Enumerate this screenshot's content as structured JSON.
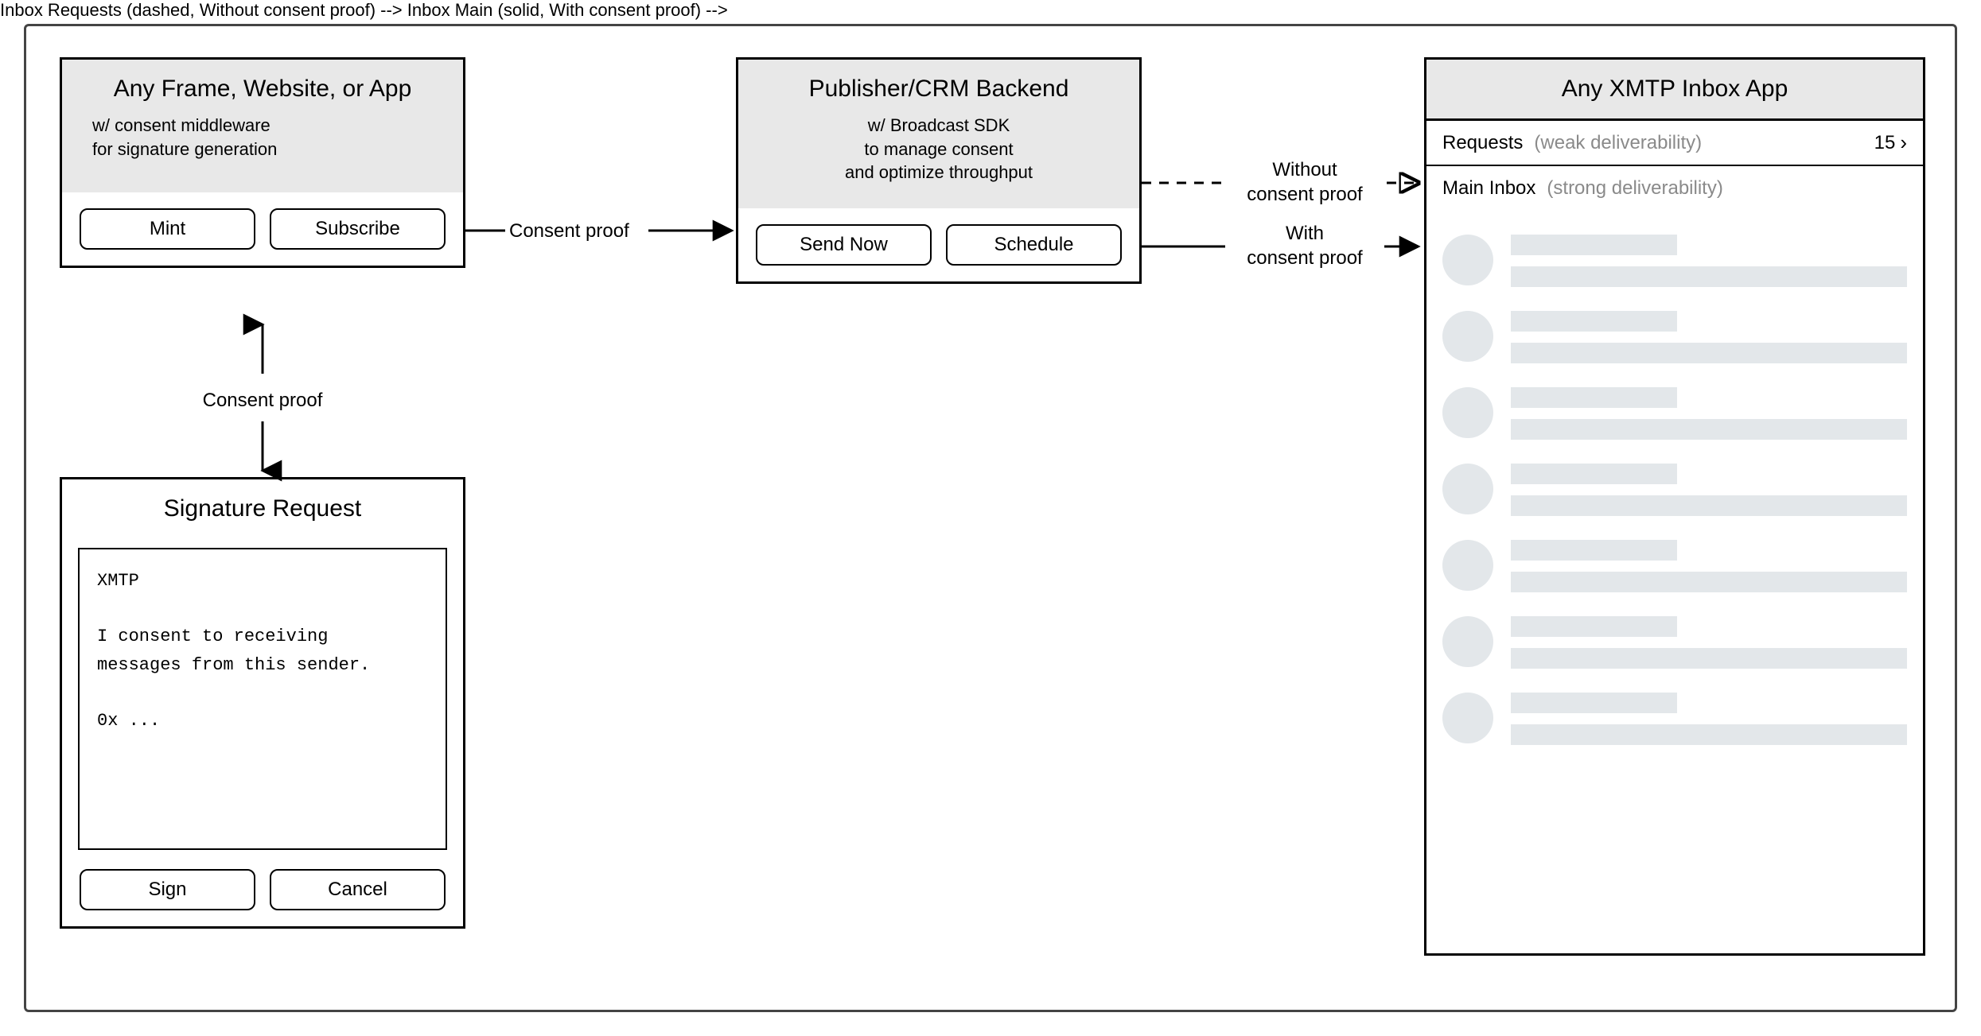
{
  "frontend": {
    "title": "Any Frame, Website, or App",
    "subtitle": "w/ consent middleware\nfor signature generation",
    "mint_label": "Mint",
    "subscribe_label": "Subscribe"
  },
  "backend": {
    "title": "Publisher/CRM Backend",
    "subtitle": "w/ Broadcast SDK\nto manage consent\nand optimize throughput",
    "send_now_label": "Send Now",
    "schedule_label": "Schedule"
  },
  "signature": {
    "title": "Signature Request",
    "body": "XMTP\n\nI consent to receiving\nmessages from this sender.\n\n0x ...",
    "sign_label": "Sign",
    "cancel_label": "Cancel"
  },
  "inbox": {
    "title": "Any XMTP Inbox App",
    "requests_label": "Requests",
    "requests_hint": "(weak deliverability)",
    "requests_count": "15",
    "main_label": "Main Inbox",
    "main_hint": "(strong deliverability)",
    "item_count": 7
  },
  "edges": {
    "fe_to_be": "Consent proof",
    "fe_to_sig": "Consent proof",
    "without": "Without\nconsent proof",
    "with": "With\nconsent proof"
  }
}
